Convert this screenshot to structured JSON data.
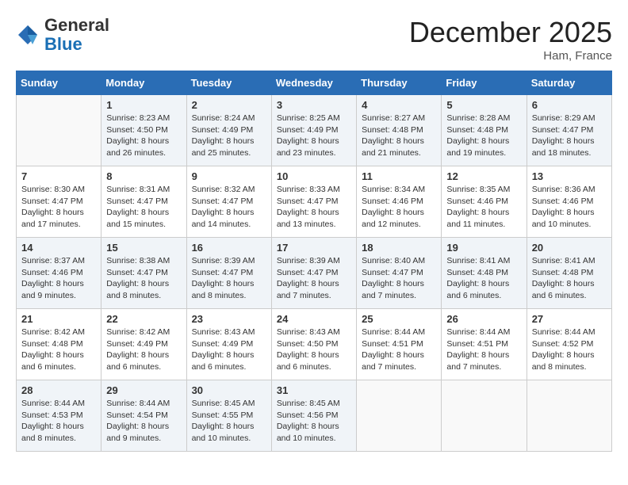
{
  "header": {
    "logo_general": "General",
    "logo_blue": "Blue",
    "month": "December 2025",
    "location": "Ham, France"
  },
  "weekdays": [
    "Sunday",
    "Monday",
    "Tuesday",
    "Wednesday",
    "Thursday",
    "Friday",
    "Saturday"
  ],
  "weeks": [
    [
      {
        "day": "",
        "sunrise": "",
        "sunset": "",
        "daylight": ""
      },
      {
        "day": "1",
        "sunrise": "Sunrise: 8:23 AM",
        "sunset": "Sunset: 4:50 PM",
        "daylight": "Daylight: 8 hours and 26 minutes."
      },
      {
        "day": "2",
        "sunrise": "Sunrise: 8:24 AM",
        "sunset": "Sunset: 4:49 PM",
        "daylight": "Daylight: 8 hours and 25 minutes."
      },
      {
        "day": "3",
        "sunrise": "Sunrise: 8:25 AM",
        "sunset": "Sunset: 4:49 PM",
        "daylight": "Daylight: 8 hours and 23 minutes."
      },
      {
        "day": "4",
        "sunrise": "Sunrise: 8:27 AM",
        "sunset": "Sunset: 4:48 PM",
        "daylight": "Daylight: 8 hours and 21 minutes."
      },
      {
        "day": "5",
        "sunrise": "Sunrise: 8:28 AM",
        "sunset": "Sunset: 4:48 PM",
        "daylight": "Daylight: 8 hours and 19 minutes."
      },
      {
        "day": "6",
        "sunrise": "Sunrise: 8:29 AM",
        "sunset": "Sunset: 4:47 PM",
        "daylight": "Daylight: 8 hours and 18 minutes."
      }
    ],
    [
      {
        "day": "7",
        "sunrise": "Sunrise: 8:30 AM",
        "sunset": "Sunset: 4:47 PM",
        "daylight": "Daylight: 8 hours and 17 minutes."
      },
      {
        "day": "8",
        "sunrise": "Sunrise: 8:31 AM",
        "sunset": "Sunset: 4:47 PM",
        "daylight": "Daylight: 8 hours and 15 minutes."
      },
      {
        "day": "9",
        "sunrise": "Sunrise: 8:32 AM",
        "sunset": "Sunset: 4:47 PM",
        "daylight": "Daylight: 8 hours and 14 minutes."
      },
      {
        "day": "10",
        "sunrise": "Sunrise: 8:33 AM",
        "sunset": "Sunset: 4:47 PM",
        "daylight": "Daylight: 8 hours and 13 minutes."
      },
      {
        "day": "11",
        "sunrise": "Sunrise: 8:34 AM",
        "sunset": "Sunset: 4:46 PM",
        "daylight": "Daylight: 8 hours and 12 minutes."
      },
      {
        "day": "12",
        "sunrise": "Sunrise: 8:35 AM",
        "sunset": "Sunset: 4:46 PM",
        "daylight": "Daylight: 8 hours and 11 minutes."
      },
      {
        "day": "13",
        "sunrise": "Sunrise: 8:36 AM",
        "sunset": "Sunset: 4:46 PM",
        "daylight": "Daylight: 8 hours and 10 minutes."
      }
    ],
    [
      {
        "day": "14",
        "sunrise": "Sunrise: 8:37 AM",
        "sunset": "Sunset: 4:46 PM",
        "daylight": "Daylight: 8 hours and 9 minutes."
      },
      {
        "day": "15",
        "sunrise": "Sunrise: 8:38 AM",
        "sunset": "Sunset: 4:47 PM",
        "daylight": "Daylight: 8 hours and 8 minutes."
      },
      {
        "day": "16",
        "sunrise": "Sunrise: 8:39 AM",
        "sunset": "Sunset: 4:47 PM",
        "daylight": "Daylight: 8 hours and 8 minutes."
      },
      {
        "day": "17",
        "sunrise": "Sunrise: 8:39 AM",
        "sunset": "Sunset: 4:47 PM",
        "daylight": "Daylight: 8 hours and 7 minutes."
      },
      {
        "day": "18",
        "sunrise": "Sunrise: 8:40 AM",
        "sunset": "Sunset: 4:47 PM",
        "daylight": "Daylight: 8 hours and 7 minutes."
      },
      {
        "day": "19",
        "sunrise": "Sunrise: 8:41 AM",
        "sunset": "Sunset: 4:48 PM",
        "daylight": "Daylight: 8 hours and 6 minutes."
      },
      {
        "day": "20",
        "sunrise": "Sunrise: 8:41 AM",
        "sunset": "Sunset: 4:48 PM",
        "daylight": "Daylight: 8 hours and 6 minutes."
      }
    ],
    [
      {
        "day": "21",
        "sunrise": "Sunrise: 8:42 AM",
        "sunset": "Sunset: 4:48 PM",
        "daylight": "Daylight: 8 hours and 6 minutes."
      },
      {
        "day": "22",
        "sunrise": "Sunrise: 8:42 AM",
        "sunset": "Sunset: 4:49 PM",
        "daylight": "Daylight: 8 hours and 6 minutes."
      },
      {
        "day": "23",
        "sunrise": "Sunrise: 8:43 AM",
        "sunset": "Sunset: 4:49 PM",
        "daylight": "Daylight: 8 hours and 6 minutes."
      },
      {
        "day": "24",
        "sunrise": "Sunrise: 8:43 AM",
        "sunset": "Sunset: 4:50 PM",
        "daylight": "Daylight: 8 hours and 6 minutes."
      },
      {
        "day": "25",
        "sunrise": "Sunrise: 8:44 AM",
        "sunset": "Sunset: 4:51 PM",
        "daylight": "Daylight: 8 hours and 7 minutes."
      },
      {
        "day": "26",
        "sunrise": "Sunrise: 8:44 AM",
        "sunset": "Sunset: 4:51 PM",
        "daylight": "Daylight: 8 hours and 7 minutes."
      },
      {
        "day": "27",
        "sunrise": "Sunrise: 8:44 AM",
        "sunset": "Sunset: 4:52 PM",
        "daylight": "Daylight: 8 hours and 8 minutes."
      }
    ],
    [
      {
        "day": "28",
        "sunrise": "Sunrise: 8:44 AM",
        "sunset": "Sunset: 4:53 PM",
        "daylight": "Daylight: 8 hours and 8 minutes."
      },
      {
        "day": "29",
        "sunrise": "Sunrise: 8:44 AM",
        "sunset": "Sunset: 4:54 PM",
        "daylight": "Daylight: 8 hours and 9 minutes."
      },
      {
        "day": "30",
        "sunrise": "Sunrise: 8:45 AM",
        "sunset": "Sunset: 4:55 PM",
        "daylight": "Daylight: 8 hours and 10 minutes."
      },
      {
        "day": "31",
        "sunrise": "Sunrise: 8:45 AM",
        "sunset": "Sunset: 4:56 PM",
        "daylight": "Daylight: 8 hours and 10 minutes."
      },
      {
        "day": "",
        "sunrise": "",
        "sunset": "",
        "daylight": ""
      },
      {
        "day": "",
        "sunrise": "",
        "sunset": "",
        "daylight": ""
      },
      {
        "day": "",
        "sunrise": "",
        "sunset": "",
        "daylight": ""
      }
    ]
  ]
}
